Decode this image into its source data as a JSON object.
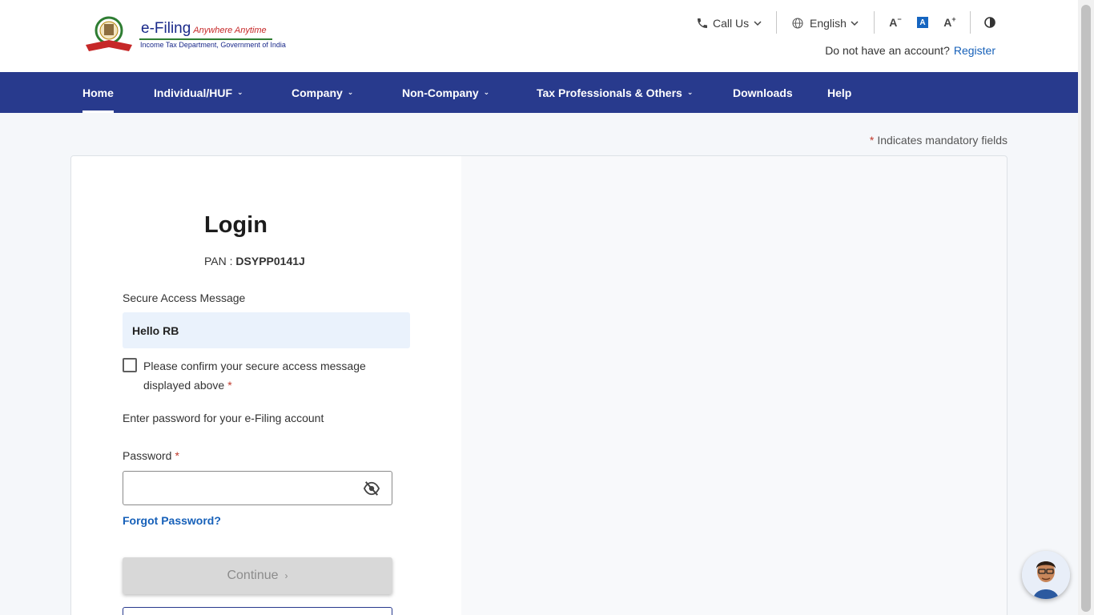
{
  "header": {
    "logo_title": "e-Filing",
    "logo_tagline": "Anywhere Anytime",
    "logo_subtitle": "Income Tax Department, Government of India",
    "call_us": "Call Us",
    "language": "English",
    "font_decrease": "A",
    "font_reset": "A",
    "font_increase": "A",
    "account_text": "Do not have an account?",
    "register_link": "Register"
  },
  "nav": {
    "items": [
      {
        "label": "Home",
        "active": true
      },
      {
        "label": "Individual/HUF"
      },
      {
        "label": "Company"
      },
      {
        "label": "Non-Company"
      },
      {
        "label": "Tax Professionals & Others"
      },
      {
        "label": "Downloads"
      },
      {
        "label": "Help"
      }
    ]
  },
  "mandatory_note": "Indicates mandatory fields",
  "login": {
    "title": "Login",
    "pan_label": "PAN :",
    "pan_value": "DSYPP0141J",
    "secure_access_label": "Secure Access Message",
    "secure_access_message": "Hello RB",
    "confirm_text": "Please confirm your secure access message displayed above",
    "enter_password_text": "Enter password for your e-Filing account",
    "password_label": "Password",
    "password_value": "",
    "forgot_password": "Forgot Password?",
    "continue_label": "Continue"
  },
  "colors": {
    "nav_bg": "#283a8d",
    "link": "#1660b9",
    "required": "#c0392b",
    "secure_box": "#eaf2fc",
    "disabled_button": "#d8d8d8"
  }
}
